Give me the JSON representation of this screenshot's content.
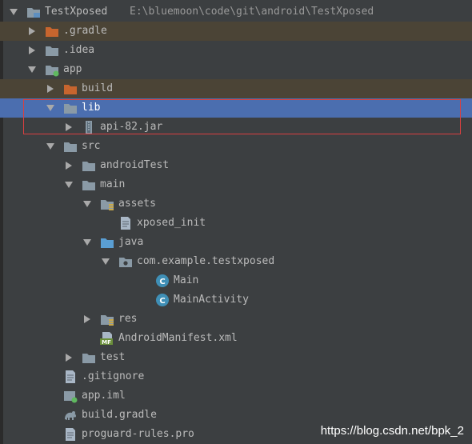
{
  "project": {
    "name": "TestXposed",
    "path": "E:\\bluemoon\\code\\git\\android\\TestXposed"
  },
  "tree": [
    {
      "name": "TestXposed",
      "icon": "project-folder-icon",
      "arrow": "down",
      "depth": 0
    },
    {
      "name": ".gradle",
      "icon": "orange-folder-icon",
      "arrow": "right",
      "depth": 1,
      "highlight": "brown"
    },
    {
      "name": ".idea",
      "icon": "grey-folder-icon",
      "arrow": "right",
      "depth": 1
    },
    {
      "name": "app",
      "icon": "module-folder-icon",
      "arrow": "down",
      "depth": 1
    },
    {
      "name": "build",
      "icon": "orange-folder-icon",
      "arrow": "right",
      "depth": 2,
      "highlight": "brown"
    },
    {
      "name": "lib",
      "icon": "grey-folder-icon",
      "arrow": "down",
      "depth": 2,
      "highlight": "selected"
    },
    {
      "name": "api-82.jar",
      "icon": "jar-file-icon",
      "arrow": "right",
      "depth": 3
    },
    {
      "name": "src",
      "icon": "grey-folder-icon",
      "arrow": "down",
      "depth": 2
    },
    {
      "name": "androidTest",
      "icon": "grey-folder-icon",
      "arrow": "right",
      "depth": 3
    },
    {
      "name": "main",
      "icon": "grey-folder-icon",
      "arrow": "down",
      "depth": 3
    },
    {
      "name": "assets",
      "icon": "resource-folder-icon",
      "arrow": "down",
      "depth": 4
    },
    {
      "name": "xposed_init",
      "icon": "text-file-icon",
      "arrow": "none",
      "depth": 5
    },
    {
      "name": "java",
      "icon": "source-folder-icon",
      "arrow": "down",
      "depth": 4
    },
    {
      "name": "com.example.testxposed",
      "icon": "package-icon",
      "arrow": "down",
      "depth": 5
    },
    {
      "name": "Main",
      "icon": "class-icon",
      "arrow": "none",
      "depth": 7
    },
    {
      "name": "MainActivity",
      "icon": "class-icon",
      "arrow": "none",
      "depth": 7
    },
    {
      "name": "res",
      "icon": "resource-folder-icon",
      "arrow": "right",
      "depth": 4
    },
    {
      "name": "AndroidManifest.xml",
      "icon": "manifest-file-icon",
      "arrow": "none",
      "depth": 4
    },
    {
      "name": "test",
      "icon": "grey-folder-icon",
      "arrow": "right",
      "depth": 3
    },
    {
      "name": ".gitignore",
      "icon": "text-file-icon",
      "arrow": "none",
      "depth": 2
    },
    {
      "name": "app.iml",
      "icon": "module-file-icon",
      "arrow": "none",
      "depth": 2
    },
    {
      "name": "build.gradle",
      "icon": "gradle-file-icon",
      "arrow": "none",
      "depth": 2
    },
    {
      "name": "proguard-rules.pro",
      "icon": "text-file-icon",
      "arrow": "none",
      "depth": 2
    }
  ],
  "watermark": "https://blog.csdn.net/bpk_2",
  "colors": {
    "background": "#3c3f41",
    "selected": "#4b6eaf",
    "excluded_highlight": "#4b4436",
    "annotation_box": "#d84040",
    "excluded_folder": "#c7652e",
    "folder": "#8a9aa6",
    "source_folder": "#5a9fd4",
    "class_icon": "#3f8fb6"
  }
}
